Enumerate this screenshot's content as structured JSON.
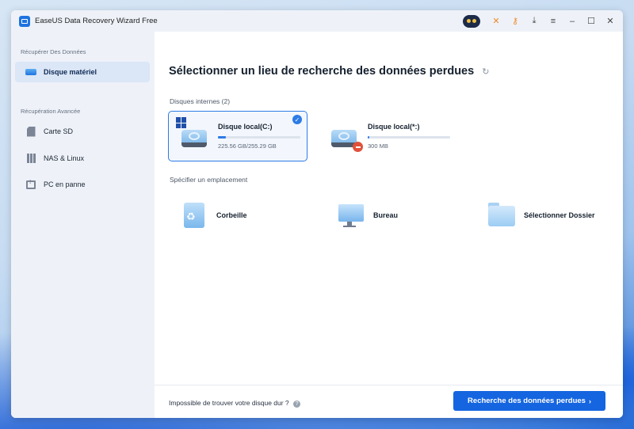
{
  "window": {
    "title": "EaseUS Data Recovery Wizard Free"
  },
  "titlebar_icons": [
    "avatar-icon",
    "gift-icon",
    "key-icon",
    "download-icon",
    "menu-icon",
    "minimize-icon",
    "maximize-icon",
    "close-icon"
  ],
  "sidebar": {
    "section1": "Récupérer Des Données",
    "section2": "Récupération Avancée",
    "items": [
      {
        "label": "Disque matériel",
        "active": true
      },
      {
        "label": "Carte SD"
      },
      {
        "label": "NAS & Linux"
      },
      {
        "label": "PC en panne"
      }
    ]
  },
  "main": {
    "title": "Sélectionner un lieu de recherche des données perdues",
    "internal_disks_label": "Disques internes (2)",
    "drives": [
      {
        "name": "Disque local(C:)",
        "size": "225.56 GB/255.29 GB",
        "used_fraction": 0.1,
        "selected": true
      },
      {
        "name": "Disque local(*:)",
        "size": "300 MB",
        "used_fraction": 0.02,
        "selected": false
      }
    ],
    "location_label": "Spécifier un emplacement",
    "locations": [
      "Corbeille",
      "Bureau",
      "Sélectionner Dossier"
    ]
  },
  "footer": {
    "help_text": "Impossible de trouver votre disque dur ?",
    "scan_button": "Recherche des données perdues"
  },
  "colors": {
    "accent": "#1565e0",
    "selected_border": "#2d7be6",
    "sidebar_bg": "#eef2f8"
  }
}
